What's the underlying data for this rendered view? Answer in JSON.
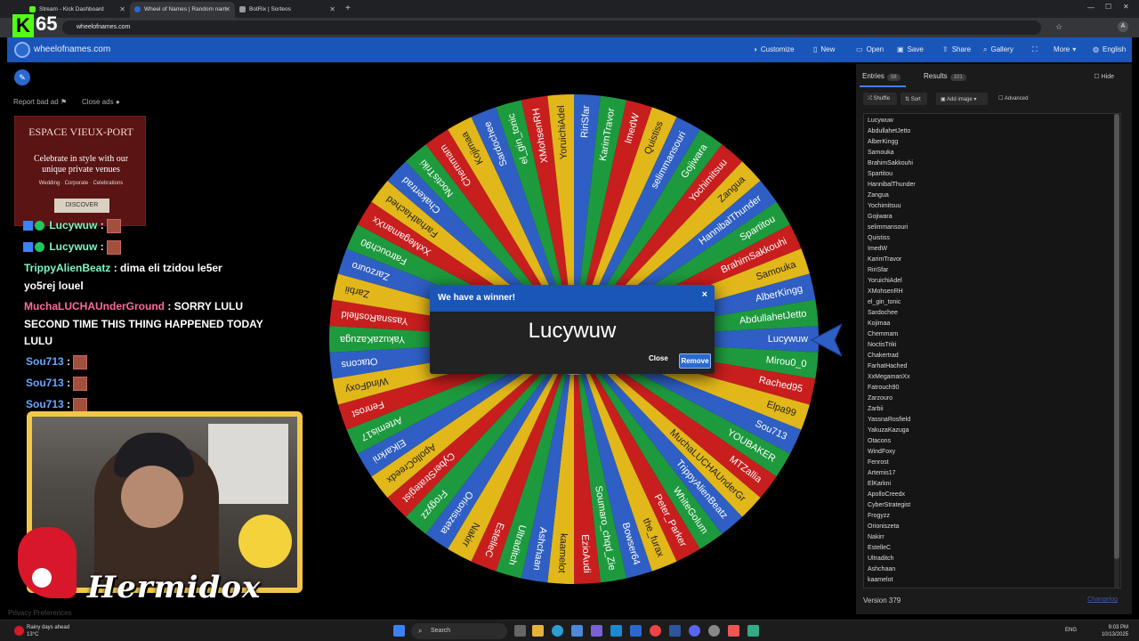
{
  "browser": {
    "tabs": [
      {
        "title": "Stream - Kick Dashboard",
        "color": "#53fc18"
      },
      {
        "title": "Wheel of Names | Random nam",
        "color": "#2a6ad0"
      },
      {
        "title": "BotRix | Sorteos",
        "color": "#999999"
      }
    ],
    "url": "wheelofnames.com"
  },
  "overlay": {
    "kick_letter": "K",
    "kick_count": "65"
  },
  "app": {
    "site_name": "wheelofnames.com",
    "menu": [
      "Customize",
      "New",
      "Open",
      "Save",
      "Share",
      "Gallery",
      "",
      "More",
      "English"
    ]
  },
  "ads": {
    "report": "Report bad ad",
    "close": "Close ads",
    "title": "ESPACE VIEUX-PORT",
    "text": "Celebrate in style with our unique private venues",
    "sub": "Wedding · Corporate · Celebrations",
    "button": "DISCOVER"
  },
  "chat": [
    {
      "name": "Lucywuw",
      "msg": ""
    },
    {
      "name": "Lucywuw",
      "msg": ""
    },
    {
      "name": "TrippyAlienBeatz",
      "msg": "dima eli tzidou le5er"
    },
    {
      "name": "",
      "msg": "yo5rej louel"
    },
    {
      "name": "MuchaLUCHAUnderGround",
      "msg": "SORRY LULU"
    },
    {
      "name": "",
      "msg": "SECOND TIME THIS THING HAPPENED TODAY"
    },
    {
      "name": "",
      "msg": "LULU"
    },
    {
      "name": "Sou713",
      "msg": ""
    },
    {
      "name": "Sou713",
      "msg": ""
    },
    {
      "name": "Sou713",
      "msg": ""
    }
  ],
  "webcam": {
    "streamer_name": "Hermidox"
  },
  "footer": {
    "privacy": "Privacy Preferences"
  },
  "wheel": {
    "colors": [
      "#1e9a3e",
      "#e2b71a",
      "#c81e1e",
      "#2f5fc4"
    ],
    "names": [
      "Lucywuw",
      "Mirou0_0",
      "Rached95",
      "Elpa99",
      "Sou713",
      "YOUBAKER",
      "MTZallia",
      "MuchaLUCHAUnderGr",
      "TrippyAlienBeatz",
      "WhiteGolum",
      "Peter_Parker",
      "the_furax",
      "Bowser64",
      "Soumaro_chqd_Zie",
      "EzioAudi",
      "kaamelot",
      "Ashchaan",
      "Ultraditch",
      "EstelleC",
      "Nakirr",
      "Orioniszeta",
      "Frogyzz",
      "CyberStrategist",
      "ApolloCreedx",
      "ElKarkni",
      "Artemis17",
      "Fenrost",
      "WindFoxy",
      "Otacons",
      "YakuzaKazuga",
      "YassnaRosfield",
      "Zarbii",
      "Zarzouro",
      "Fatrouch90",
      "XxMegamanXx",
      "FarhatHached",
      "Chakertrad",
      "NoctisTriki",
      "Chemmam",
      "Kojimaa",
      "Sardochee",
      "el_gin_tonic",
      "XMohsenRH",
      "YoruichiAdel",
      "RiriSfar",
      "KarimTravor",
      "ImedW",
      "Quistiss",
      "selimmansouri",
      "Gojiwara",
      "Yochimitsuu",
      "Zangua",
      "HannibalThunder",
      "Spartitou",
      "BrahimSakkouhi",
      "Samouka",
      "AlberKingg",
      "AbdullahetJetto"
    ]
  },
  "modal": {
    "title": "We have a winner!",
    "winner": "Lucywuw",
    "close": "Close",
    "remove": "Remove"
  },
  "panel": {
    "tab_entries": "Entries",
    "entries_count": "58",
    "tab_results": "Results",
    "results_count": "101",
    "hide": "Hide",
    "shuffle": "Shuffle",
    "sort": "Sort",
    "add_image": "Add image",
    "advanced": "Advanced",
    "entries": [
      "Lucywuw",
      "AbdullahetJetto",
      "AlberKingg",
      "Samouka",
      "BrahimSakkouhi",
      "Spartitou",
      "HannibalThunder",
      "Zangua",
      "Yochimitsuu",
      "Gojiwara",
      "selimmansouri",
      "Quistiss",
      "ImedW",
      "KarimTravor",
      "RiriSfar",
      "YoruichiAdel",
      "XMohsenRH",
      "el_gin_tonic",
      "Sardochee",
      "Kojimaa",
      "Chemmam",
      "NoctisTriki",
      "Chakertrad",
      "FarhatHached",
      "XxMegamanXx",
      "Fatrouch90",
      "Zarzouro",
      "Zarbii",
      "YassnaRosfield",
      "YakuzaKazuga",
      "Otacons",
      "WindFoxy",
      "Fenrost",
      "Artemis17",
      "ElKarkni",
      "ApolloCreedx",
      "CyberStrategist",
      "Frogyzz",
      "Orioniszeta",
      "Nakirr",
      "EstelleC",
      "Ultraditch",
      "Ashchaan",
      "kaamelot"
    ],
    "version": "Version 379",
    "changelog": "Changelog"
  },
  "taskbar": {
    "weather_line1": "Rainy days ahead",
    "weather_line2": "13°C",
    "search": "Search",
    "lang": "ENG",
    "time": "9:03 PM",
    "date": "10/13/2025"
  }
}
